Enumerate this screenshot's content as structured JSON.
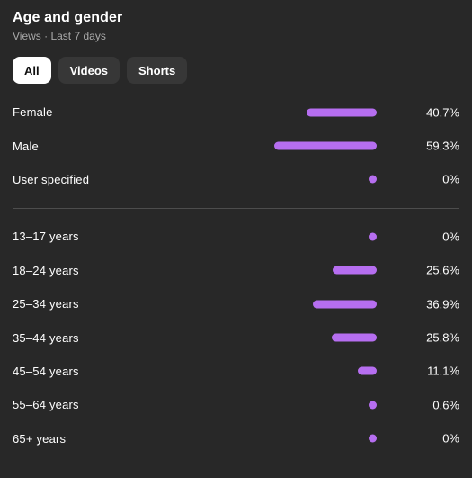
{
  "header": {
    "title": "Age and gender",
    "subtitle": "Views · Last 7 days"
  },
  "filters": {
    "chips": [
      {
        "label": "All",
        "active": true
      },
      {
        "label": "Videos",
        "active": false
      },
      {
        "label": "Shorts",
        "active": false
      }
    ]
  },
  "colors": {
    "background": "#282828",
    "bar": "#b66ef0",
    "text_primary": "#ffffff",
    "text_secondary": "#aaaaaa",
    "divider": "#4d4d4d",
    "chip_inactive": "#373737",
    "chip_active": "#ffffff"
  },
  "chart_data": {
    "type": "bar",
    "title": "Age and gender",
    "subtitle": "Views · Last 7 days",
    "xlabel": "",
    "ylabel": "",
    "orientation": "horizontal",
    "value_unit": "%",
    "xlim": [
      0,
      100
    ],
    "grid": false,
    "legend": null,
    "groups": [
      {
        "name": "gender",
        "categories": [
          "Female",
          "Male",
          "User specified"
        ],
        "values": [
          40.7,
          59.3,
          0
        ],
        "value_labels": [
          "40.7%",
          "59.3%",
          "0%"
        ]
      },
      {
        "name": "age",
        "categories": [
          "13–17 years",
          "18–24 years",
          "25–34 years",
          "35–44 years",
          "45–54 years",
          "55–64 years",
          "65+ years"
        ],
        "values": [
          0,
          25.6,
          36.9,
          25.8,
          11.1,
          0.6,
          0
        ],
        "value_labels": [
          "0%",
          "25.6%",
          "36.9%",
          "25.8%",
          "11.1%",
          "0.6%",
          "0%"
        ]
      }
    ]
  },
  "gender_rows": [
    {
      "label": "Female",
      "value": 40.7,
      "value_label": "40.7%"
    },
    {
      "label": "Male",
      "value": 59.3,
      "value_label": "59.3%"
    },
    {
      "label": "User specified",
      "value": 0,
      "value_label": "0%"
    }
  ],
  "age_rows": [
    {
      "label": "13–17 years",
      "value": 0,
      "value_label": "0%"
    },
    {
      "label": "18–24 years",
      "value": 25.6,
      "value_label": "25.6%"
    },
    {
      "label": "25–34 years",
      "value": 36.9,
      "value_label": "36.9%"
    },
    {
      "label": "35–44 years",
      "value": 25.8,
      "value_label": "25.8%"
    },
    {
      "label": "45–54 years",
      "value": 11.1,
      "value_label": "11.1%"
    },
    {
      "label": "55–64 years",
      "value": 0.6,
      "value_label": "0.6%"
    },
    {
      "label": "65+ years",
      "value": 0,
      "value_label": "0%"
    }
  ]
}
